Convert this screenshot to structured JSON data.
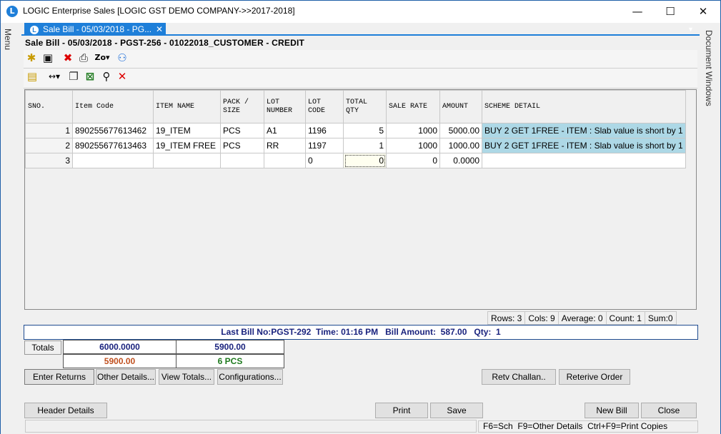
{
  "window": {
    "app_name": "LOGIC Enterprise Sales",
    "company": "[LOGIC GST DEMO COMPANY->>2017-2018]",
    "minimize_glyph": "—",
    "maximize_glyph": "☐",
    "close_glyph": "✕"
  },
  "side": {
    "menu_label": "Menu",
    "doc_windows_label": "Document Windows"
  },
  "tab": {
    "label": "Sale Bill - 05/03/2018 - PG...",
    "close": "✕",
    "dropdown": "▼"
  },
  "bill_header": "Sale Bill - 05/03/2018 - PGST-256 - 01022018_CUSTOMER - CREDIT",
  "toolbar1": [
    "new-icon",
    "save-icon",
    "delete-icon",
    "print-icon",
    "zoom-icon",
    "users-icon"
  ],
  "toolbar2": [
    "calendar-icon",
    "expand-icon",
    "copy-icon",
    "excel-icon",
    "binoculars-icon",
    "clear-icon"
  ],
  "grid": {
    "columns": [
      "SNO.",
      "Item Code",
      "ITEM NAME",
      "PACK / SIZE",
      "LOT NUMBER",
      "LOT CODE",
      "TOTAL QTY",
      "SALE RATE",
      "AMOUNT",
      "SCHEME DETAIL"
    ],
    "rows": [
      {
        "sno": "1",
        "item_code": "890255677613462",
        "item_name": "19_ITEM",
        "pack": "PCS",
        "lot_number": "A1",
        "lot_code": "1196",
        "total_qty": "5",
        "sale_rate": "1000",
        "amount": "5000.00",
        "scheme": "BUY 2 GET 1FREE - ITEM : Slab value is short by 1"
      },
      {
        "sno": "2",
        "item_code": "890255677613463",
        "item_name": "19_ITEM FREE",
        "pack": "PCS",
        "lot_number": "RR",
        "lot_code": "1197",
        "total_qty": "1",
        "sale_rate": "1000",
        "amount": "1000.00",
        "scheme": "BUY 2 GET 1FREE - ITEM : Slab value is short by 1"
      },
      {
        "sno": "3",
        "item_code": "",
        "item_name": "",
        "pack": "",
        "lot_number": "",
        "lot_code": "0",
        "total_qty": "0",
        "sale_rate": "0",
        "amount": "0.0000",
        "scheme": ""
      }
    ]
  },
  "status": {
    "rows": "Rows: 3",
    "cols": "Cols: 9",
    "average": "Average: 0",
    "count": "Count: 1",
    "sum": "Sum:0"
  },
  "last_bill": "Last Bill No:PGST-292  Time: 01:16 PM   Bill Amount:  587.00   Qty:  1",
  "totals": {
    "label": "Totals",
    "amount": "6000.0000",
    "net": "5900.00",
    "net2": "5900.00",
    "qty": "6 PCS",
    "colors": {
      "blue": "#1a237e",
      "orange": "#c0501f",
      "green": "#1e7a1e"
    }
  },
  "buttons": {
    "enter_returns": "Enter Returns",
    "other_details": "Other Details...",
    "view_totals": "View Totals...",
    "configurations": "Configurations...",
    "retv_challan": "Retv Challan..",
    "retrieve_order": "Reterive Order",
    "header_details": "Header Details",
    "print": "Print",
    "save": "Save",
    "new_bill": "New Bill",
    "close": "Close"
  },
  "shortcut_hint": "F6=Sch  F9=Other Details  Ctrl+F9=Print Copies"
}
